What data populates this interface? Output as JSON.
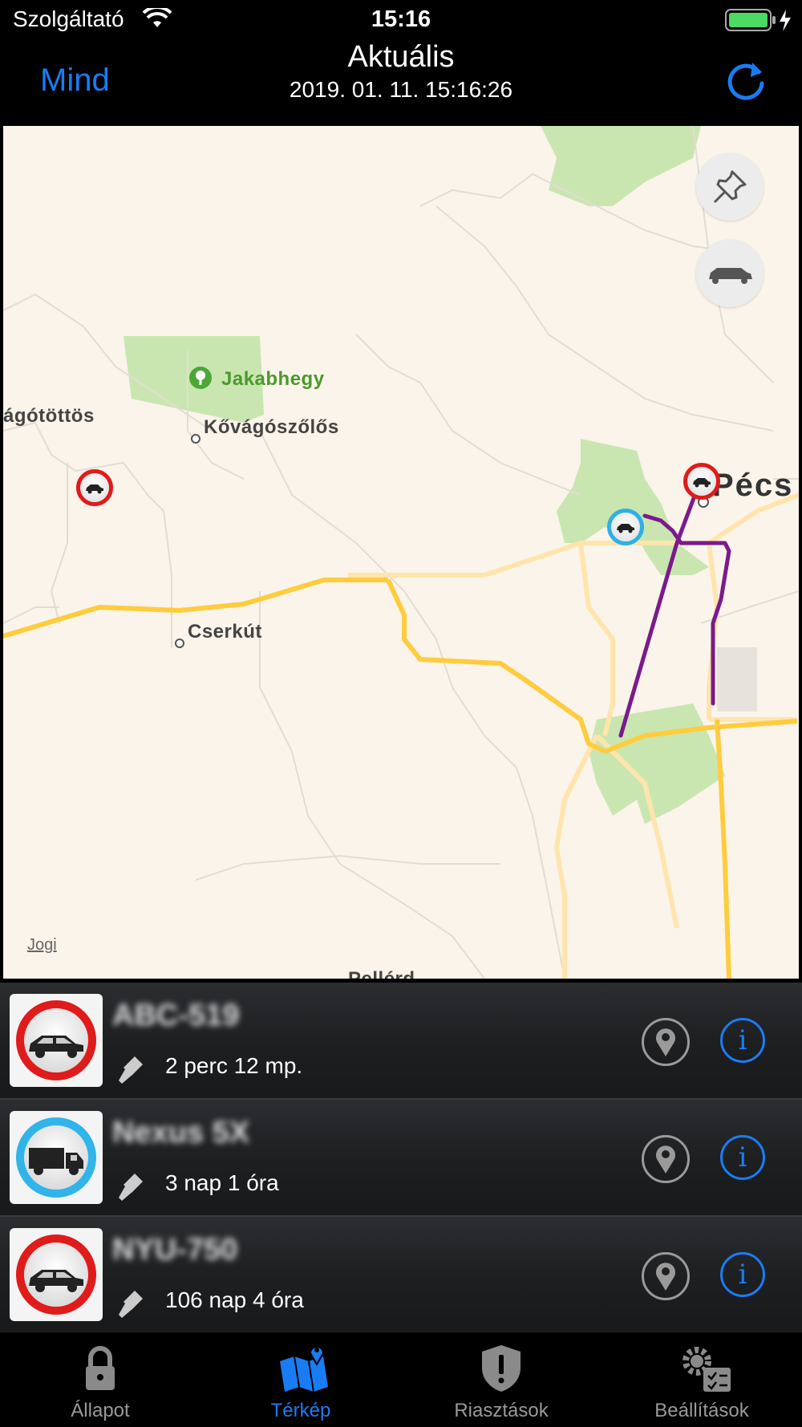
{
  "status_bar": {
    "carrier": "Szolgáltató",
    "time": "15:16"
  },
  "nav": {
    "left_button": "Mind",
    "title": "Aktuális",
    "subtitle": "2019. 01. 11. 15:16:26"
  },
  "map": {
    "labels": {
      "park": "Jakabhegy",
      "village1": "ágótöttös",
      "village2": "Kővágószőlős",
      "village3": "Cserkút",
      "city": "Pécs",
      "bottom_partial": "Pellérd"
    },
    "legal": "Jogi",
    "buttons": [
      "pin-icon",
      "cars-icon"
    ]
  },
  "vehicles": [
    {
      "name": "ABC-519",
      "duration": "2 perc 12 mp.",
      "status_color": "#e01b1b",
      "icon": "car-icon"
    },
    {
      "name": "Nexus 5X",
      "duration": "3 nap 1 óra",
      "status_color": "#30b4ea",
      "icon": "truck-icon"
    },
    {
      "name": "NYU-750",
      "duration": "106 nap 4 óra",
      "status_color": "#e01b1b",
      "icon": "car-icon"
    }
  ],
  "tabs": [
    {
      "label": "Állapot",
      "icon": "lock-icon",
      "active": false
    },
    {
      "label": "Térkép",
      "icon": "map-icon",
      "active": true
    },
    {
      "label": "Riasztások",
      "icon": "shield-alert-icon",
      "active": false
    },
    {
      "label": "Beállítások",
      "icon": "settings-icon",
      "active": false
    }
  ]
}
